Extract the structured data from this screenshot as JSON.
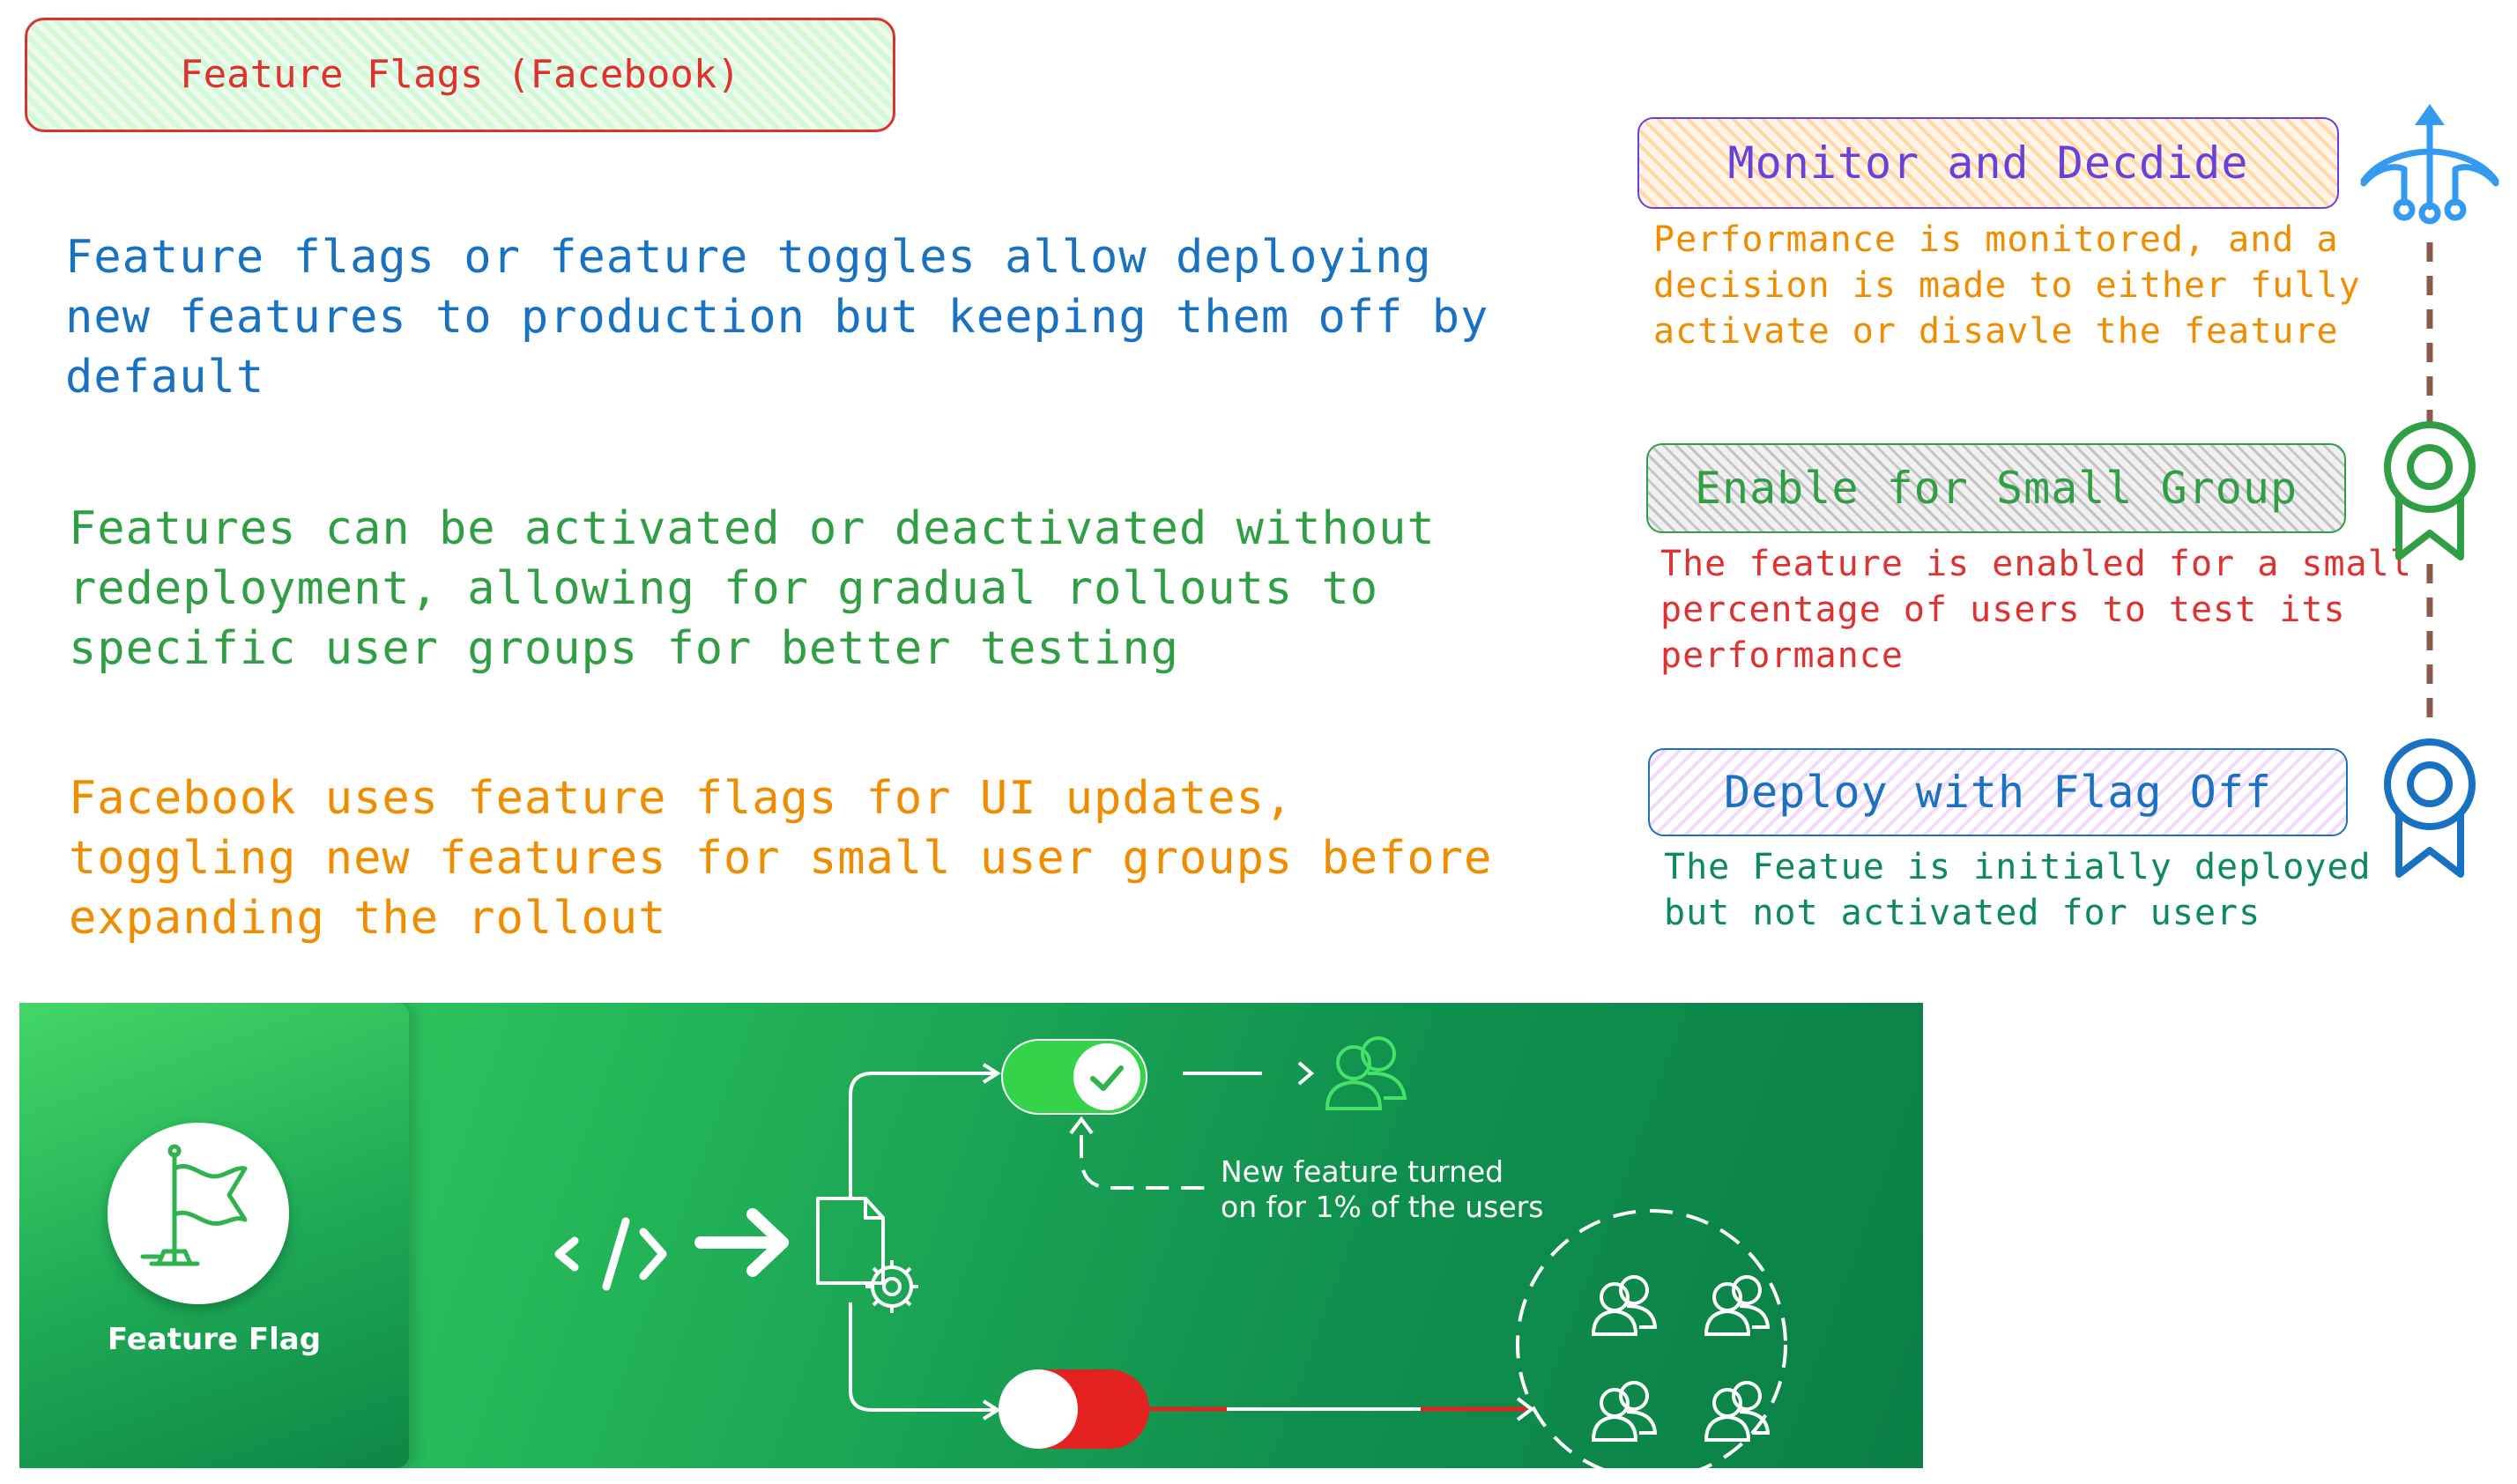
{
  "title": "Feature Flags (Facebook)",
  "paragraphs": {
    "p1": "Feature flags or feature toggles allow deploying\nnew features to production but keeping them off by\ndefault",
    "p2": "Features can be activated or deactivated without\nredeployment, allowing for gradual rollouts to\nspecific user groups for better testing",
    "p3": "Facebook uses feature flags for UI updates,\ntoggling new features for small user groups before\nexpanding the rollout"
  },
  "steps": [
    {
      "title": "Monitor and Decdide",
      "desc": "Performance is monitored, and a\ndecision is made to either fully\nactivate or disavle the feature"
    },
    {
      "title": "Enable for Small Group",
      "desc": "The feature is enabled for a small\npercentage of users to test its\nperformance"
    },
    {
      "title": "Deploy with Flag Off",
      "desc": "The Featue is initially deployed\nbut not activated for users"
    }
  ],
  "icons": {
    "top": "fork-arrow-icon",
    "middle": "award-ribbon-icon",
    "bottom": "award-ribbon-icon",
    "flag": "flag-icon",
    "code": "code-icon",
    "arrow": "arrow-right-icon",
    "document": "document-gear-icon",
    "users": "users-icon"
  },
  "banner": {
    "card_label": "Feature Flag",
    "note": "New feature turned\non for 1% of the users"
  },
  "colors": {
    "red": "#e03131",
    "blue": "#1971c2",
    "green": "#2f9e44",
    "orange": "#f08c00",
    "violet": "#6741d9",
    "connector": "#8c5a4a"
  }
}
